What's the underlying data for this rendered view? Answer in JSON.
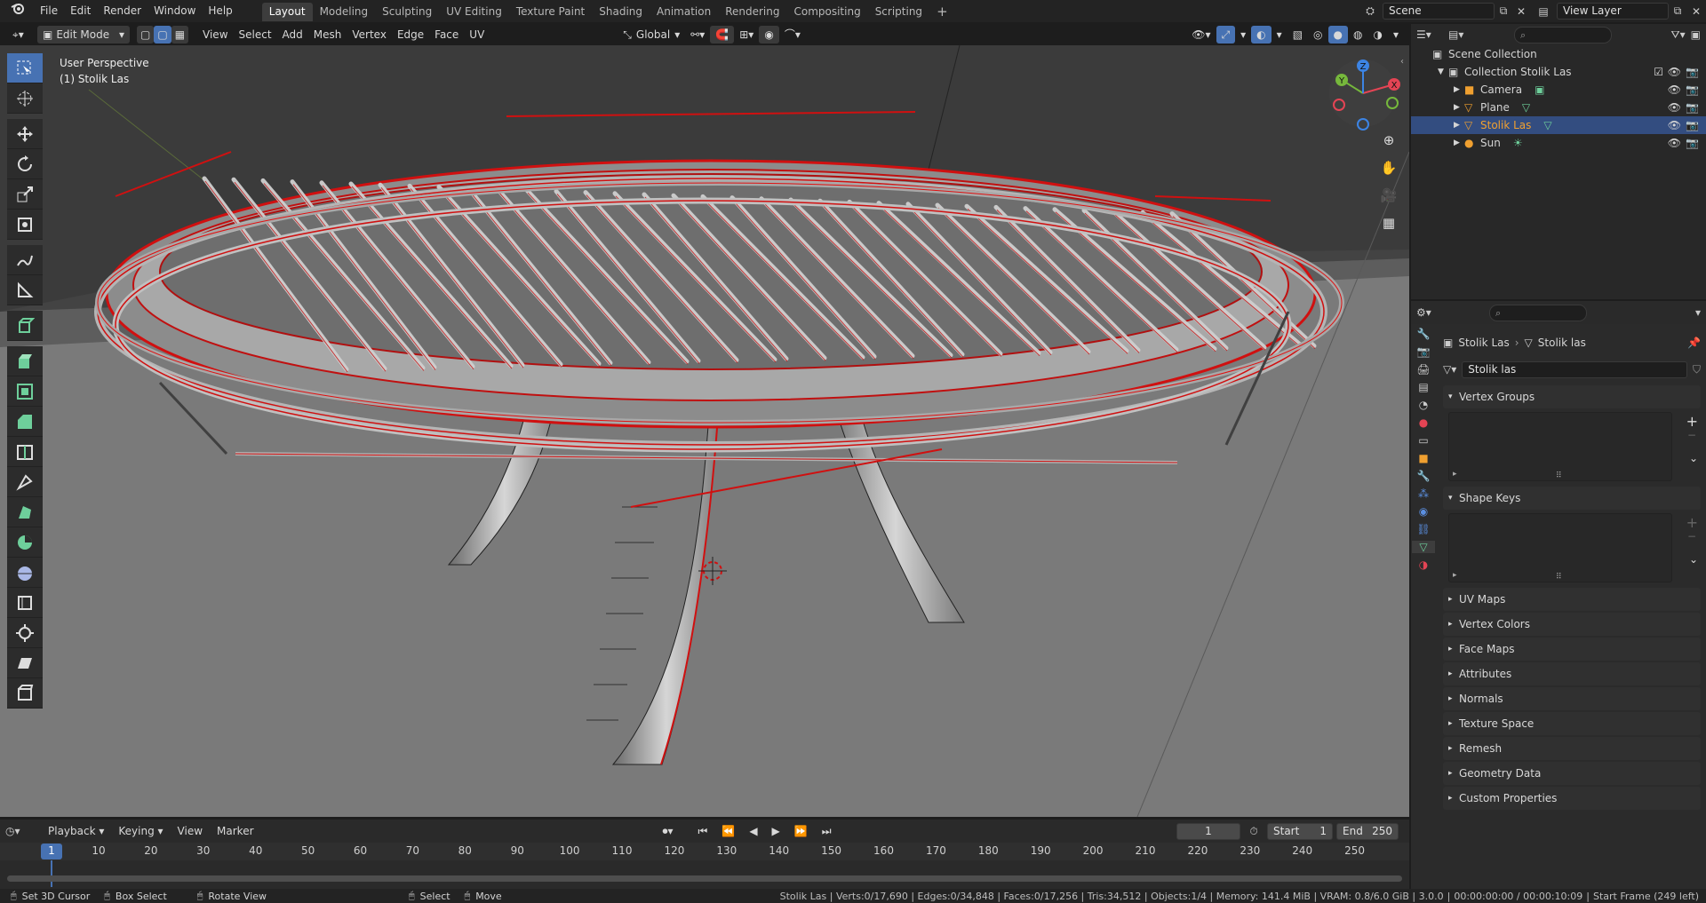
{
  "app": {
    "menus": [
      "File",
      "Edit",
      "Render",
      "Window",
      "Help"
    ],
    "workspaces": [
      "Layout",
      "Modeling",
      "Sculpting",
      "UV Editing",
      "Texture Paint",
      "Shading",
      "Animation",
      "Rendering",
      "Compositing",
      "Scripting"
    ],
    "active_workspace": "Layout",
    "scene": "Scene",
    "view_layer": "View Layer",
    "add_tab": "+"
  },
  "viewport": {
    "mode": "Edit Mode",
    "menus": [
      "View",
      "Select",
      "Add",
      "Mesh",
      "Vertex",
      "Edge",
      "Face",
      "UV"
    ],
    "orientation": "Global",
    "overlay_text_line1": "User Perspective",
    "overlay_text_line2": "(1) Stolik Las",
    "gizmo": {
      "x": "X",
      "y": "Y",
      "z": "Z"
    }
  },
  "outliner": {
    "search_placeholder": "",
    "root": "Scene Collection",
    "collection": "Collection Stolik Las",
    "items": [
      {
        "name": "Camera",
        "icon": "camera-icon",
        "selected": false
      },
      {
        "name": "Plane",
        "icon": "mesh-icon",
        "selected": false
      },
      {
        "name": "Stolik Las",
        "icon": "mesh-icon",
        "selected": true
      },
      {
        "name": "Sun",
        "icon": "sun-icon",
        "selected": false
      }
    ]
  },
  "properties": {
    "breadcrumb_object": "Stolik Las",
    "breadcrumb_data": "Stolik las",
    "data_name": "Stolik las",
    "panels": [
      {
        "label": "Vertex Groups",
        "open": true
      },
      {
        "label": "Shape Keys",
        "open": true
      },
      {
        "label": "UV Maps",
        "open": false
      },
      {
        "label": "Vertex Colors",
        "open": false
      },
      {
        "label": "Face Maps",
        "open": false
      },
      {
        "label": "Attributes",
        "open": false
      },
      {
        "label": "Normals",
        "open": false
      },
      {
        "label": "Texture Space",
        "open": false
      },
      {
        "label": "Remesh",
        "open": false
      },
      {
        "label": "Geometry Data",
        "open": false
      },
      {
        "label": "Custom Properties",
        "open": false
      }
    ]
  },
  "timeline": {
    "menus": [
      "Playback",
      "Keying",
      "View",
      "Marker"
    ],
    "current_frame": "1",
    "start_label": "Start",
    "start": "1",
    "end_label": "End",
    "end": "250",
    "ticks": [
      "1",
      "10",
      "20",
      "30",
      "40",
      "50",
      "60",
      "70",
      "80",
      "90",
      "100",
      "110",
      "120",
      "130",
      "140",
      "150",
      "160",
      "170",
      "180",
      "190",
      "200",
      "210",
      "220",
      "230",
      "240",
      "250"
    ]
  },
  "status": {
    "hint1": "Set 3D Cursor",
    "hint2": "Box Select",
    "hint3": "Rotate View",
    "hint4": "Select",
    "hint5": "Move",
    "stats": "Stolik Las | Verts:0/17,690 | Edges:0/34,848 | Faces:0/17,256 | Tris:34,512 | Objects:1/4 | Memory: 141.4 MiB | VRAM: 0.8/6.0 GiB | 3.0.0",
    "time": "00:00:00:00 / 00:00:10:09",
    "frame_info": "Start Frame (249 left)"
  },
  "colors": {
    "accent": "#4772b3",
    "selected_object": "#f0a030",
    "edge_highlight": "#e01010",
    "axis_x": "#e44454",
    "axis_y": "#76b83c",
    "axis_z": "#3c84e4"
  }
}
